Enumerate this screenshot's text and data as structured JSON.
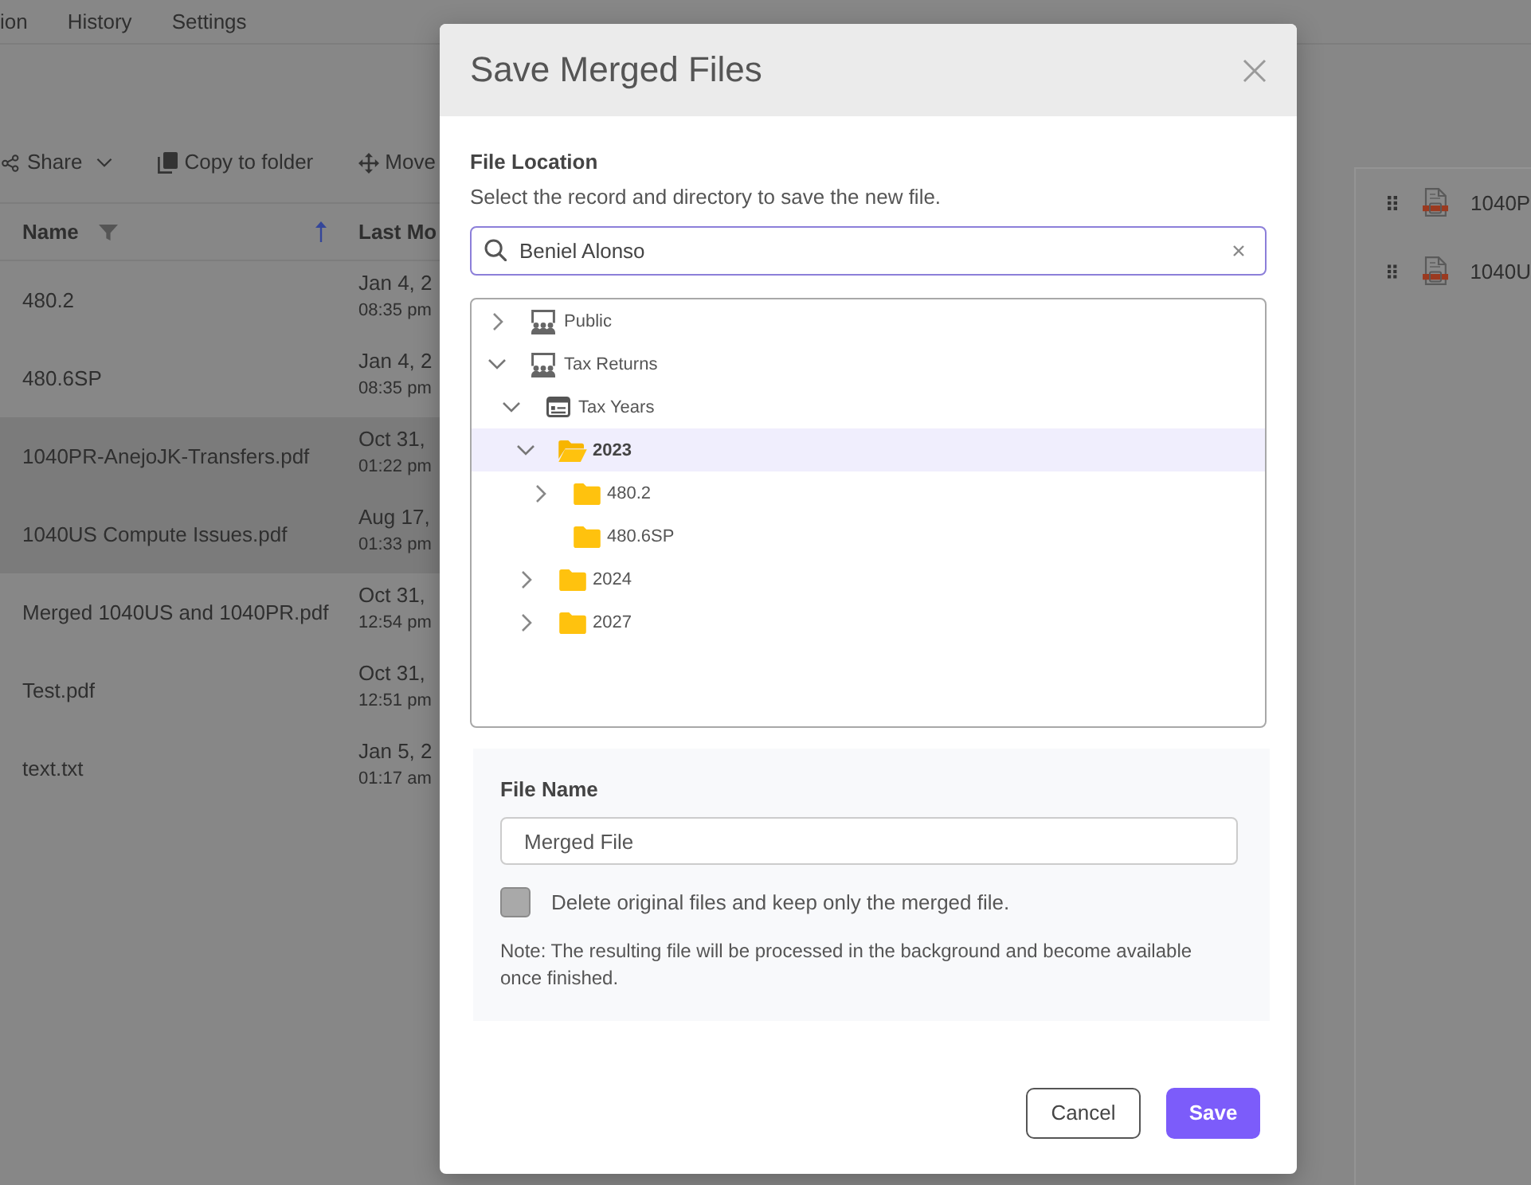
{
  "background": {
    "nav_tabs": [
      {
        "label": "ion"
      },
      {
        "label": "History"
      },
      {
        "label": "Settings"
      }
    ],
    "toolbar": [
      {
        "kind": "share",
        "label": "Share",
        "menu": true
      },
      {
        "kind": "copy",
        "label": "Copy to folder",
        "menu": false
      },
      {
        "kind": "move",
        "label": "Move",
        "menu": false
      }
    ],
    "table": {
      "columns": [
        {
          "label": "Name"
        },
        {
          "label": "Last Mo"
        }
      ],
      "rows": [
        {
          "name": "480.2",
          "date": "Jan 4, 2",
          "time": "08:35 pm",
          "selected": false
        },
        {
          "name": "480.6SP",
          "date": "Jan 4, 2",
          "time": "08:35 pm",
          "selected": false
        },
        {
          "name": "1040PR-AnejoJK-Transfers.pdf",
          "date": "Oct 31,",
          "time": "01:22 pm",
          "selected": true
        },
        {
          "name": "1040US Compute Issues.pdf",
          "date": "Aug 17,",
          "time": "01:33 pm",
          "selected": true
        },
        {
          "name": "Merged 1040US and 1040PR.pdf",
          "date": "Oct 31,",
          "time": "12:54 pm",
          "selected": false
        },
        {
          "name": "Test.pdf",
          "date": "Oct 31,",
          "time": "12:51 pm",
          "selected": false
        },
        {
          "name": "text.txt",
          "date": "Jan 5, 2",
          "time": "01:17 am",
          "selected": false
        }
      ]
    },
    "side_list": [
      {
        "label": "1040P"
      },
      {
        "label": "1040U"
      }
    ]
  },
  "dialog": {
    "title": "Save Merged Files",
    "location": {
      "heading": "File Location",
      "description": "Select the record and directory to save the new file.",
      "search_value": "Beniel Alonso"
    },
    "tree": [
      {
        "label": "Public",
        "kind": "group",
        "has_children": true,
        "expanded": false,
        "selected": false
      },
      {
        "label": "Tax Returns",
        "kind": "group",
        "has_children": true,
        "expanded": true,
        "selected": false,
        "children": [
          {
            "label": "Tax Years",
            "kind": "years",
            "has_children": true,
            "expanded": true,
            "selected": false,
            "children": [
              {
                "label": "2023",
                "kind": "folder",
                "has_children": true,
                "expanded": true,
                "selected": true,
                "children": [
                  {
                    "label": "480.2",
                    "kind": "folder",
                    "has_children": true,
                    "expanded": false,
                    "selected": false
                  },
                  {
                    "label": "480.6SP",
                    "kind": "folder",
                    "has_children": false,
                    "expanded": false,
                    "selected": false
                  }
                ]
              },
              {
                "label": "2024",
                "kind": "folder",
                "has_children": true,
                "expanded": false,
                "selected": false
              },
              {
                "label": "2027",
                "kind": "folder",
                "has_children": true,
                "expanded": false,
                "selected": false
              }
            ]
          }
        ]
      }
    ],
    "file_name": {
      "heading": "File Name",
      "value": "Merged File"
    },
    "delete_option": {
      "label": "Delete original files and keep only the merged file.",
      "checked": false
    },
    "note": "Note: The resulting file will be processed in the background and become available once finished.",
    "buttons": [
      {
        "label": "Cancel",
        "kind": "secondary"
      },
      {
        "label": "Save",
        "kind": "primary"
      }
    ]
  }
}
